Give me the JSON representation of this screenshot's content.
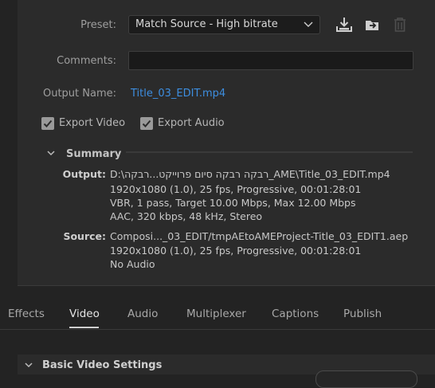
{
  "preset": {
    "label": "Preset:",
    "value": "Match Source - High bitrate",
    "icons": [
      "save-preset-icon",
      "import-preset-icon",
      "delete-preset-icon"
    ]
  },
  "comments": {
    "label": "Comments:",
    "value": ""
  },
  "output_name": {
    "label": "Output Name:",
    "value": "Title_03_EDIT.mp4"
  },
  "export": {
    "video_label": "Export Video",
    "audio_label": "Export Audio",
    "video_checked": true,
    "audio_checked": true
  },
  "summary": {
    "title": "Summary",
    "output_label": "Output:",
    "output_lines": [
      "D:\\רבקה רבקה סיום פרוייקט...רבקה_AME\\Title_03_EDIT.mp4",
      "1920x1080 (1.0), 25 fps, Progressive, 00:01:28:01",
      "VBR, 1 pass, Target 10.00 Mbps, Max 12.00 Mbps",
      "AAC, 320 kbps, 48 kHz, Stereo"
    ],
    "source_label": "Source:",
    "source_lines": [
      "Composi..._03_EDIT/tmpAEtoAMEProject-Title_03_EDIT1.aep",
      "1920x1080 (1.0), 25 fps, Progressive, 00:01:28:01",
      "No Audio"
    ]
  },
  "tabs": [
    {
      "label": "Effects",
      "active": false
    },
    {
      "label": "Video",
      "active": true
    },
    {
      "label": "Audio",
      "active": false
    },
    {
      "label": "Multiplexer",
      "active": false
    },
    {
      "label": "Captions",
      "active": false
    },
    {
      "label": "Publish",
      "active": false
    }
  ],
  "section": {
    "title": "Basic Video Settings"
  },
  "colors": {
    "accent_link": "#3d8ee0",
    "panel": "#2b2b2b",
    "background": "#232323"
  }
}
